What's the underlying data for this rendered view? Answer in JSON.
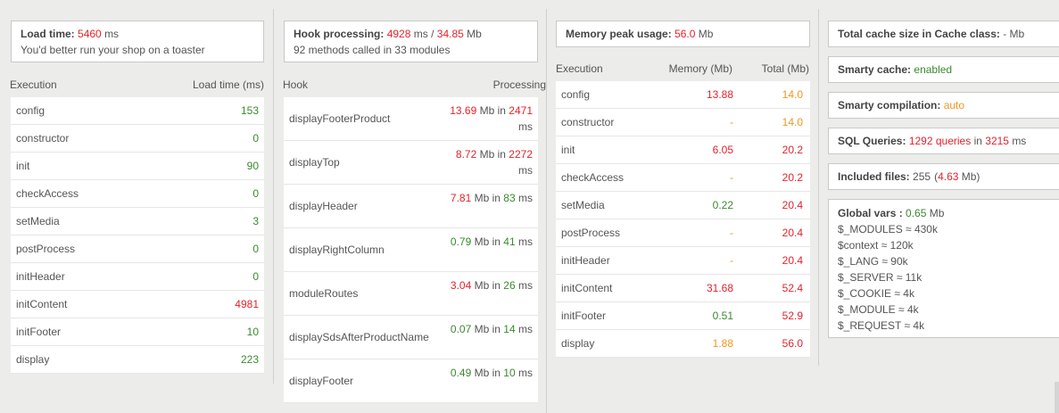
{
  "load_box": {
    "label": "Load time:",
    "value": "5460",
    "unit": "ms",
    "note": "You'd better run your shop on a toaster"
  },
  "exec_table": {
    "col_execution": "Execution",
    "col_load": "Load time (ms)",
    "rows": [
      {
        "name": "config",
        "value": "153",
        "color": "green"
      },
      {
        "name": "constructor",
        "value": "0",
        "color": "green"
      },
      {
        "name": "init",
        "value": "90",
        "color": "green"
      },
      {
        "name": "checkAccess",
        "value": "0",
        "color": "green"
      },
      {
        "name": "setMedia",
        "value": "3",
        "color": "green"
      },
      {
        "name": "postProcess",
        "value": "0",
        "color": "green"
      },
      {
        "name": "initHeader",
        "value": "0",
        "color": "green"
      },
      {
        "name": "initContent",
        "value": "4981",
        "color": "red"
      },
      {
        "name": "initFooter",
        "value": "10",
        "color": "green"
      },
      {
        "name": "display",
        "value": "223",
        "color": "green"
      }
    ]
  },
  "hook_box": {
    "label": "Hook processing:",
    "time": "4928",
    "time_unit": "ms",
    "slash": "/",
    "mem": "34.85",
    "mem_unit": "Mb",
    "note": "92 methods called in 33 modules"
  },
  "hook_table": {
    "col_hook": "Hook",
    "col_processing": "Processing",
    "mb_in": "Mb in",
    "ms": "ms",
    "rows": [
      {
        "name": "displayFooterProduct",
        "mem": "13.69",
        "mem_color": "red",
        "time": "2471",
        "time_color": "red"
      },
      {
        "name": "displayTop",
        "mem": "8.72",
        "mem_color": "red",
        "time": "2272",
        "time_color": "red"
      },
      {
        "name": "displayHeader",
        "mem": "7.81",
        "mem_color": "red",
        "time": "83",
        "time_color": "green"
      },
      {
        "name": "displayRightColumn",
        "mem": "0.79",
        "mem_color": "green",
        "time": "41",
        "time_color": "green"
      },
      {
        "name": "moduleRoutes",
        "mem": "3.04",
        "mem_color": "red",
        "time": "26",
        "time_color": "green"
      },
      {
        "name": "displaySdsAfterProductName",
        "mem": "0.07",
        "mem_color": "green",
        "time": "14",
        "time_color": "green"
      },
      {
        "name": "displayFooter",
        "mem": "0.49",
        "mem_color": "green",
        "time": "10",
        "time_color": "green"
      }
    ]
  },
  "mem_box": {
    "label": "Memory peak usage:",
    "value": "56.0",
    "unit": "Mb"
  },
  "mem_table": {
    "col_execution": "Execution",
    "col_memory": "Memory (Mb)",
    "col_total": "Total (Mb)",
    "rows": [
      {
        "name": "config",
        "mem": "13.88",
        "mem_color": "red",
        "total": "14.0",
        "total_color": "orange"
      },
      {
        "name": "constructor",
        "mem": "-",
        "mem_color": "orange",
        "total": "14.0",
        "total_color": "orange"
      },
      {
        "name": "init",
        "mem": "6.05",
        "mem_color": "red",
        "total": "20.2",
        "total_color": "red"
      },
      {
        "name": "checkAccess",
        "mem": "-",
        "mem_color": "orange",
        "total": "20.2",
        "total_color": "red"
      },
      {
        "name": "setMedia",
        "mem": "0.22",
        "mem_color": "green",
        "total": "20.4",
        "total_color": "red"
      },
      {
        "name": "postProcess",
        "mem": "-",
        "mem_color": "orange",
        "total": "20.4",
        "total_color": "red"
      },
      {
        "name": "initHeader",
        "mem": "-",
        "mem_color": "orange",
        "total": "20.4",
        "total_color": "red"
      },
      {
        "name": "initContent",
        "mem": "31.68",
        "mem_color": "red",
        "total": "52.4",
        "total_color": "red"
      },
      {
        "name": "initFooter",
        "mem": "0.51",
        "mem_color": "green",
        "total": "52.9",
        "total_color": "red"
      },
      {
        "name": "display",
        "mem": "1.88",
        "mem_color": "orange",
        "total": "56.0",
        "total_color": "red"
      }
    ]
  },
  "right": {
    "cache_size_label": "Total cache size in Cache class:",
    "cache_size_value": "- Mb",
    "smarty_cache_label": "Smarty cache:",
    "smarty_cache_value": "enabled",
    "smarty_comp_label": "Smarty compilation:",
    "smarty_comp_value": "auto",
    "sql_label": "SQL Queries:",
    "sql_count": "1292",
    "sql_queries_word": "queries",
    "sql_in": "in",
    "sql_time": "3215",
    "sql_ms": "ms",
    "files_label": "Included files:",
    "files_count": "255",
    "files_open": "(",
    "files_size": "4.63",
    "files_close": "Mb)",
    "global_label": "Global vars :",
    "global_value": "0.65",
    "global_unit": "Mb",
    "globals": [
      "$_MODULES ≈ 430k",
      "$context ≈ 120k",
      "$_LANG ≈ 90k",
      "$_SERVER ≈ 11k",
      "$_COOKIE ≈ 4k",
      "$_MODULE ≈ 4k",
      "$_REQUEST ≈ 4k"
    ]
  },
  "colors": {
    "red": "#e0242c",
    "green": "#3a8a2e",
    "orange": "#f0961f"
  }
}
